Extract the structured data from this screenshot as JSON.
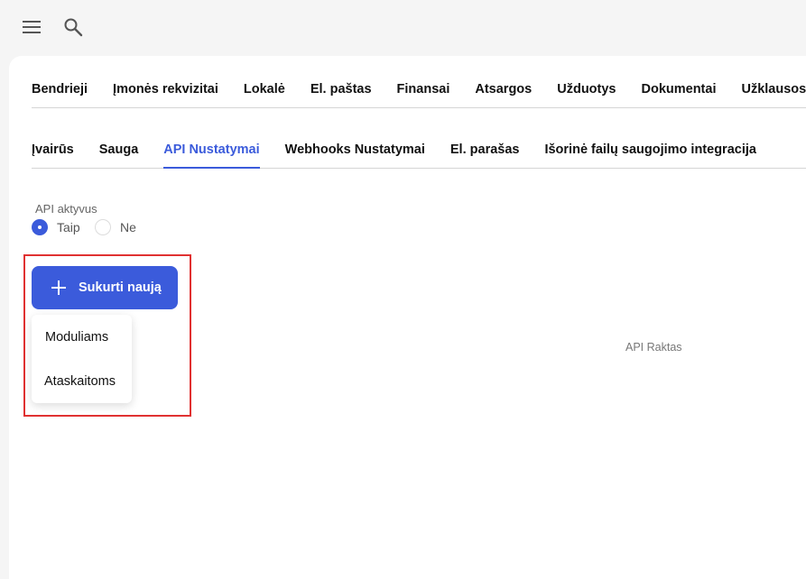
{
  "topbar": {
    "menu_icon": "menu-icon",
    "search_icon": "search-icon"
  },
  "primary_tabs": [
    {
      "label": "Bendrieji"
    },
    {
      "label": "Įmonės rekvizitai"
    },
    {
      "label": "Lokalė"
    },
    {
      "label": "El. paštas"
    },
    {
      "label": "Finansai"
    },
    {
      "label": "Atsargos"
    },
    {
      "label": "Užduotys"
    },
    {
      "label": "Dokumentai"
    },
    {
      "label": "Užklausos"
    }
  ],
  "secondary_tabs": [
    {
      "label": "Įvairūs"
    },
    {
      "label": "Sauga"
    },
    {
      "label": "API Nustatymai"
    },
    {
      "label": "Webhooks Nustatymai"
    },
    {
      "label": "El. parašas"
    },
    {
      "label": "Išorinė failų saugojimo integracija"
    }
  ],
  "active_secondary_tab": "API Nustatymai",
  "api_active": {
    "label": "API aktyvus",
    "options": [
      {
        "label": "Taip",
        "selected": true
      },
      {
        "label": "Ne",
        "selected": false
      }
    ]
  },
  "create_button": {
    "label": "Sukurti naują",
    "icon": "plus-icon"
  },
  "create_menu": [
    {
      "label": "Moduliams"
    },
    {
      "label": "Ataskaitoms"
    }
  ],
  "table": {
    "api_key_header": "API Raktas"
  },
  "colors": {
    "accent": "#3b5bdb",
    "highlight": "#e03131"
  }
}
